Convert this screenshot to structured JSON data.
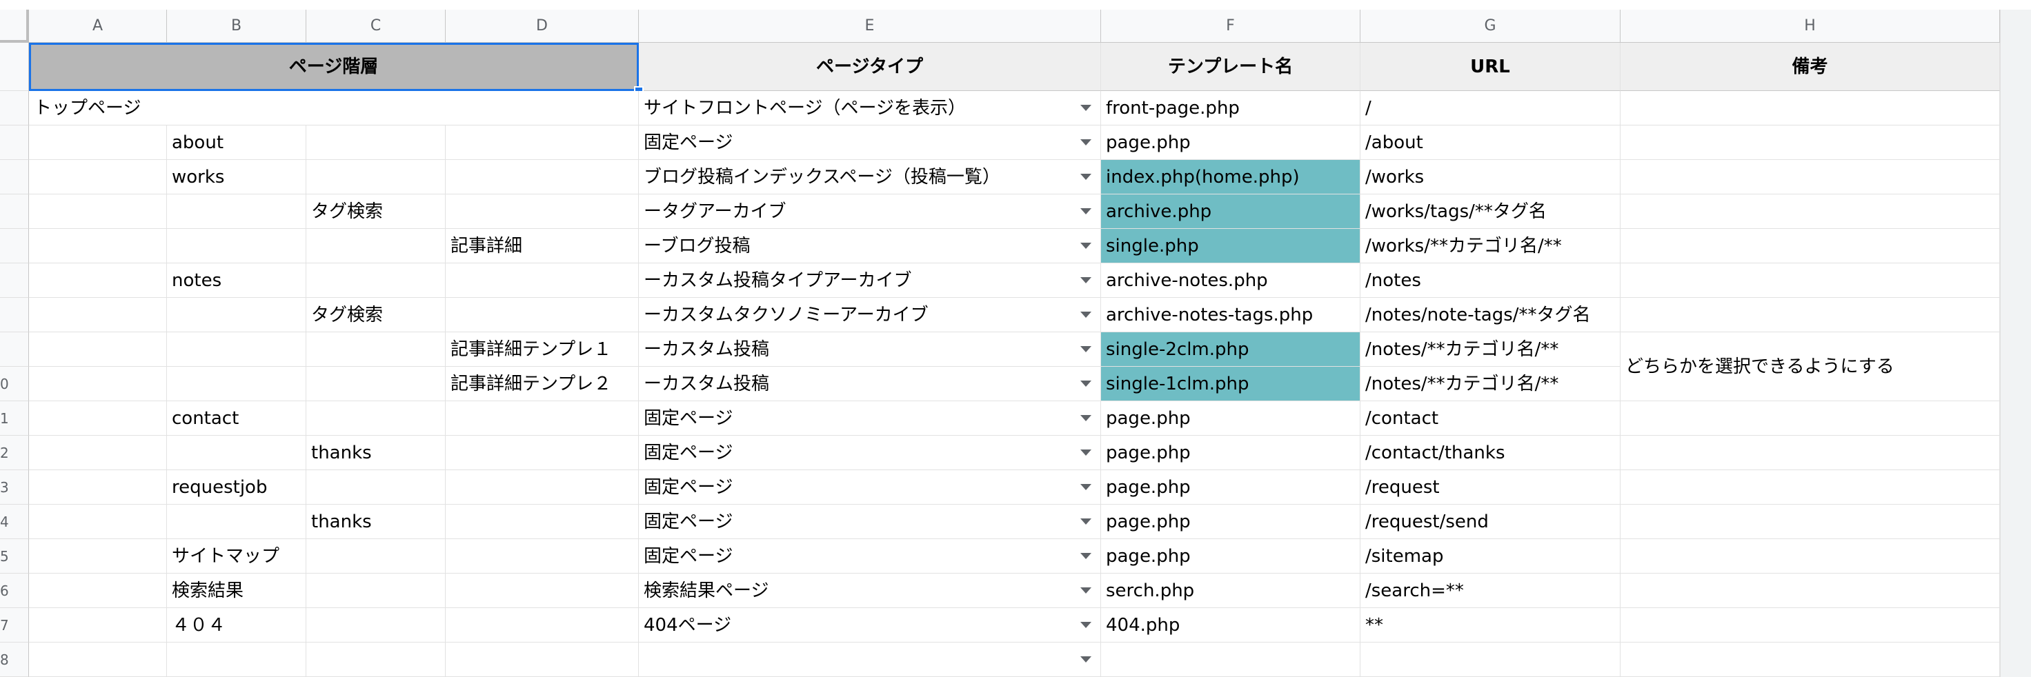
{
  "columns": [
    "A",
    "B",
    "C",
    "D",
    "E",
    "F",
    "G",
    "H"
  ],
  "header": {
    "page_level": "ページ階層",
    "page_type": "ページタイプ",
    "template": "テンプレート名",
    "url": "URL",
    "notes": "備考"
  },
  "row_numbers": [
    "",
    "",
    "",
    "",
    "",
    "",
    "",
    "",
    "",
    "0",
    "1",
    "2",
    "3",
    "4",
    "5",
    "6",
    "7",
    "8"
  ],
  "rows": [
    {
      "level": "A",
      "name": "トップページ",
      "type": "サイトフロントページ（ページを表示）",
      "template": "front-page.php",
      "url": "/",
      "template_highlight": false
    },
    {
      "level": "B",
      "name": "about",
      "type": "固定ページ",
      "template": "page.php",
      "url": "/about",
      "template_highlight": false
    },
    {
      "level": "B",
      "name": "works",
      "type": "ブログ投稿インデックスページ（投稿一覧）",
      "template": "index.php(home.php)",
      "url": "/works",
      "template_highlight": true
    },
    {
      "level": "C",
      "name": "タグ検索",
      "type": "ータグアーカイブ",
      "template": "archive.php",
      "url": "/works/tags/**タグ名",
      "template_highlight": true
    },
    {
      "level": "D",
      "name": "記事詳細",
      "type": "ーブログ投稿",
      "template": "single.php",
      "url": "/works/**カテゴリ名/**",
      "template_highlight": true
    },
    {
      "level": "B",
      "name": "notes",
      "type": "ーカスタム投稿タイプアーカイブ",
      "template": "archive-notes.php",
      "url": "/notes",
      "template_highlight": false
    },
    {
      "level": "C",
      "name": "タグ検索",
      "type": "ーカスタムタクソノミーアーカイブ",
      "template": "archive-notes-tags.php",
      "url": "/notes/note-tags/**タグ名",
      "template_highlight": false
    },
    {
      "level": "D",
      "name": "記事詳細テンプレ１",
      "type": "ーカスタム投稿",
      "template": "single-2clm.php",
      "url": "/notes/**カテゴリ名/**",
      "template_highlight": true
    },
    {
      "level": "D",
      "name": "記事詳細テンプレ２",
      "type": "ーカスタム投稿",
      "template": "single-1clm.php",
      "url": "/notes/**カテゴリ名/**",
      "template_highlight": true
    },
    {
      "level": "B",
      "name": "contact",
      "type": "固定ページ",
      "template": "page.php",
      "url": "/contact",
      "template_highlight": false
    },
    {
      "level": "C",
      "name": "thanks",
      "type": "固定ページ",
      "template": "page.php",
      "url": "/contact/thanks",
      "template_highlight": false
    },
    {
      "level": "B",
      "name": "requestjob",
      "type": "固定ページ",
      "template": "page.php",
      "url": "/request",
      "template_highlight": false
    },
    {
      "level": "C",
      "name": "thanks",
      "type": "固定ページ",
      "template": "page.php",
      "url": "/request/send",
      "template_highlight": false
    },
    {
      "level": "B",
      "name": "サイトマップ",
      "type": "固定ページ",
      "template": "page.php",
      "url": "/sitemap",
      "template_highlight": false
    },
    {
      "level": "B",
      "name": "検索結果",
      "type": "検索結果ページ",
      "template": "serch.php",
      "url": "/search=**",
      "template_highlight": false
    },
    {
      "level": "B",
      "name": "４０４",
      "type": "404ページ",
      "template": "404.php",
      "url": "**",
      "template_highlight": false
    },
    {
      "level": "B",
      "name": "",
      "type": "",
      "template": "",
      "url": "",
      "template_highlight": false
    }
  ],
  "merged_note": "どちらかを選択できるようにする",
  "colors": {
    "teal": "#6fbdc4",
    "selection": "#1a73e8",
    "header_bg": "#efefef",
    "selected_header_bg": "#b7b7b7"
  }
}
